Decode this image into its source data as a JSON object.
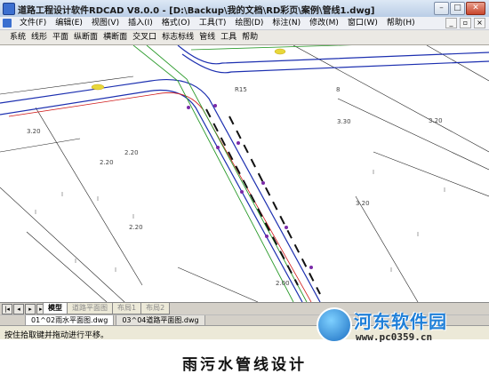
{
  "window": {
    "title": "道路工程设计软件RDCAD V8.0.0 - [D:\\Backup\\我的文档\\RD彩页\\案例\\管线1.dwg]"
  },
  "menu": [
    "文件(F)",
    "编辑(E)",
    "视图(V)",
    "插入(I)",
    "格式(O)",
    "工具(T)",
    "绘图(D)",
    "标注(N)",
    "修改(M)",
    "窗口(W)",
    "帮助(H)"
  ],
  "toolbar": [
    "系统",
    "线形",
    "平面",
    "纵断面",
    "横断面",
    "交叉口",
    "标志标线",
    "管线",
    "工具",
    "帮助"
  ],
  "drawing": {
    "elevation_labels": [
      "3.20",
      "2.20",
      "2.20",
      "3.30",
      "3.20",
      "2.20",
      "2.00",
      "3.20"
    ],
    "text_labels": [
      "R15",
      "8"
    ]
  },
  "layout_tabs": [
    "模型",
    "道路平面图",
    "布局1",
    "布局2"
  ],
  "file_tabs": [
    "01^02雨水平面图.dwg",
    "03^04道路平面图.dwg"
  ],
  "status": "按住拾取键并拖动进行平移。",
  "caption": "雨污水管线设计",
  "watermark": {
    "title": "河东软件园",
    "url": "www.pc0359.cn"
  }
}
